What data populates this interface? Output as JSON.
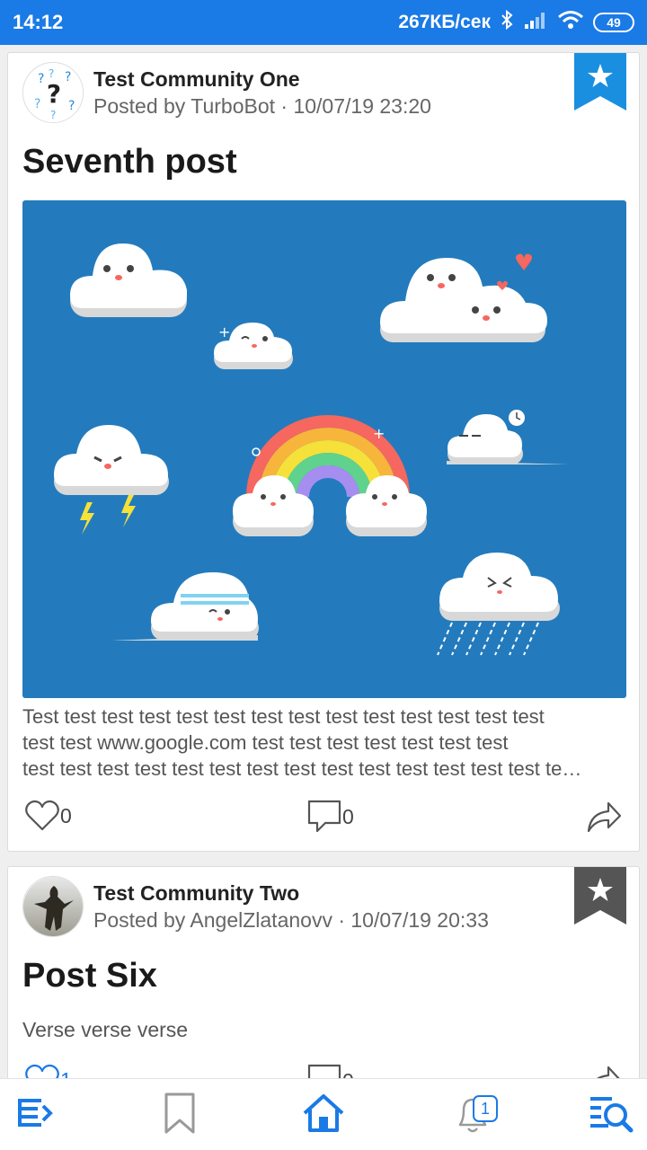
{
  "status_bar": {
    "time": "14:12",
    "network_speed": "267КБ/сек",
    "battery": "49",
    "icons": [
      "bluetooth-icon",
      "signal-icon",
      "wifi-icon",
      "battery-icon"
    ]
  },
  "posts": [
    {
      "community": "Test Community One",
      "meta": "Posted by TurboBot · 10/07/19 23:20",
      "title": "Seventh post",
      "body_lines": [
        "Test test test test test test test test test test test test test test",
        "test test www.google.com test test test test test test test",
        "test test test test test test test test test test test test test test te…"
      ],
      "likes": "0",
      "comments": "0",
      "bookmarked": true
    },
    {
      "community": "Test Community Two",
      "meta": "Posted by AngelZlatanovv · 10/07/19 20:33",
      "title": "Post Six",
      "body": "Verse verse verse",
      "likes": "1",
      "comments": "0",
      "bookmarked": false
    }
  ],
  "bottom_nav": {
    "items": [
      "menu-icon",
      "bookmark-icon",
      "home-icon",
      "notifications-icon",
      "search-icon"
    ],
    "notification_count": "1"
  },
  "colors": {
    "accent": "#1a7ae6",
    "image_bg": "#237bbd",
    "bookmark_active": "#1a8fe0",
    "bookmark_inactive": "#555555"
  }
}
